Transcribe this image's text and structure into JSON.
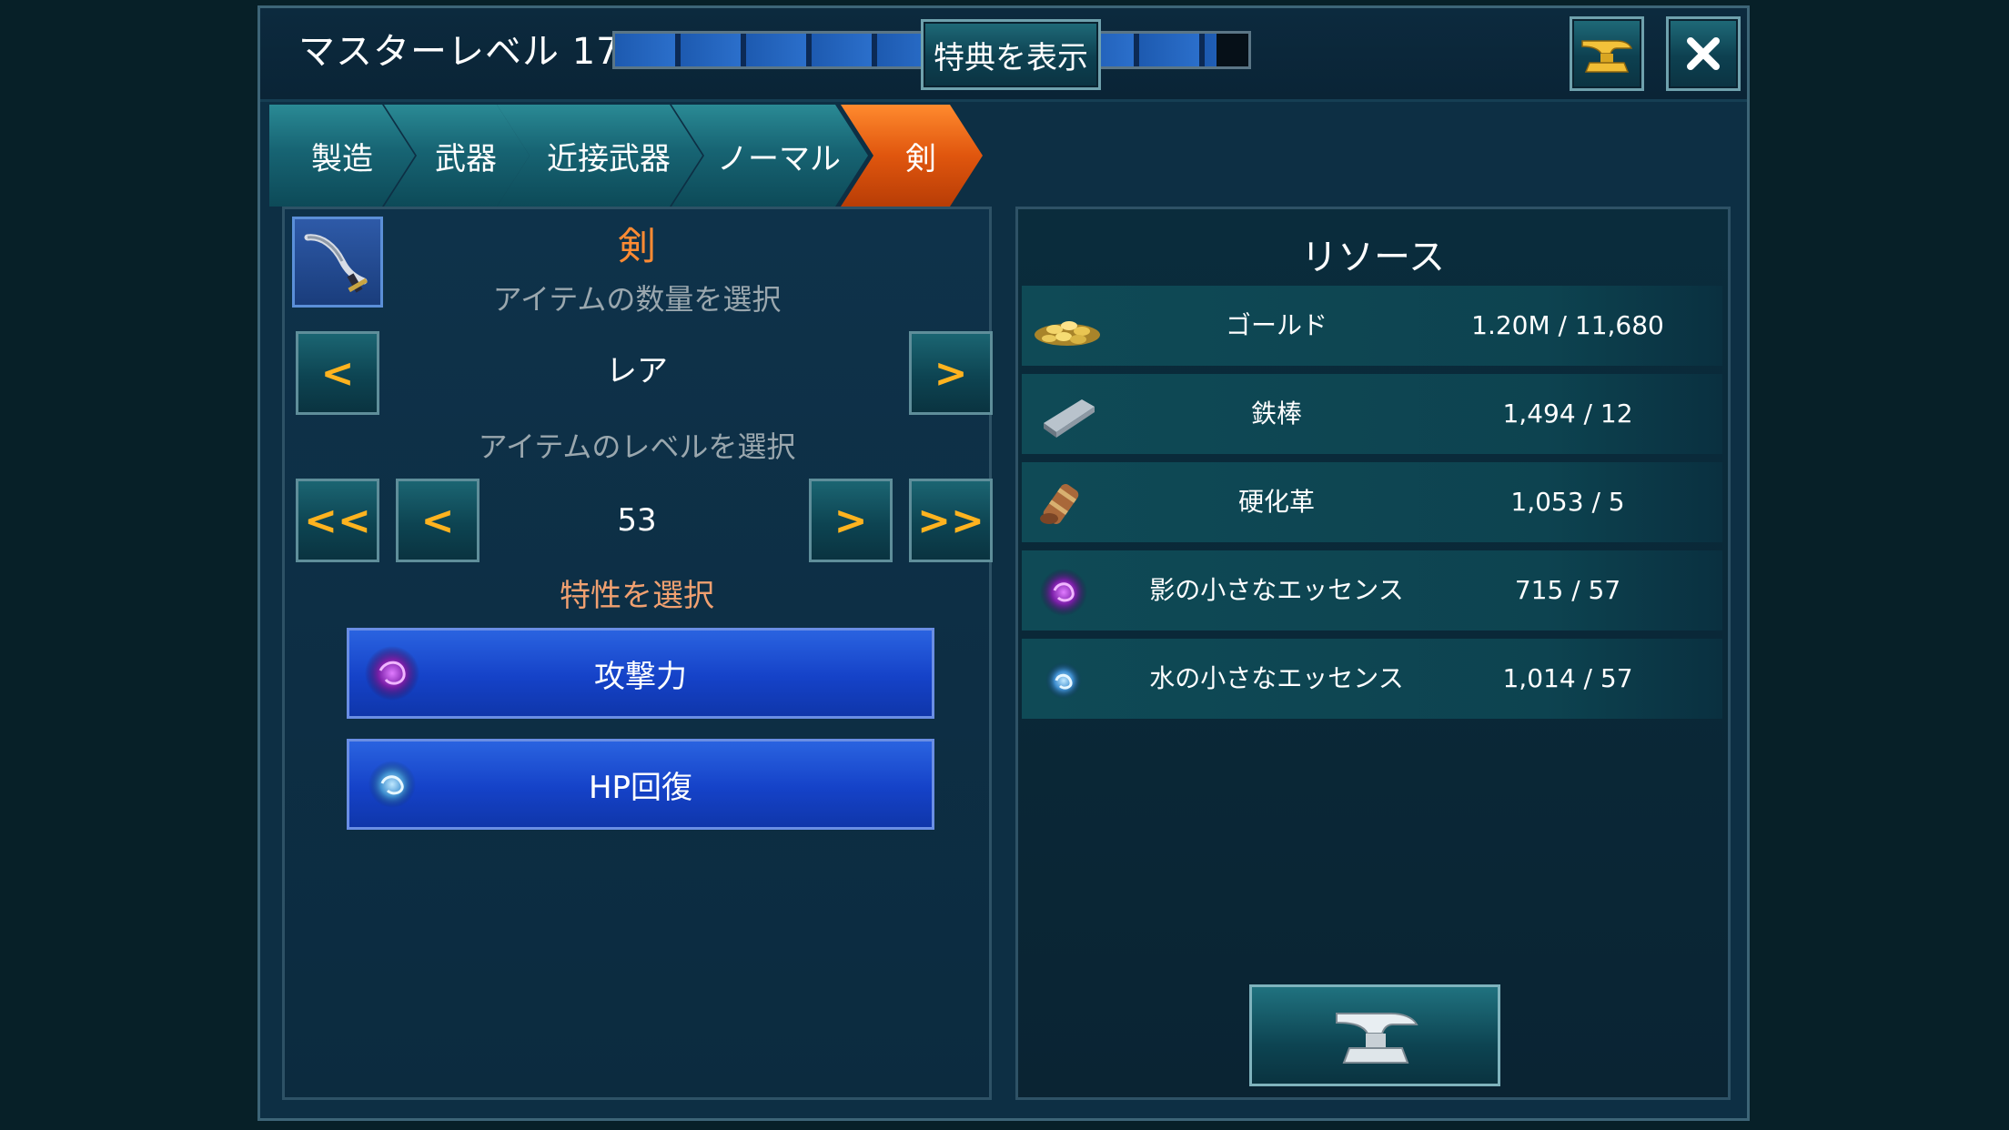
{
  "header": {
    "master_level_label": "マスターレベル 17",
    "xp_progress": 0.95,
    "benefits_button": "特典を表示"
  },
  "tabs": [
    {
      "label": "製造"
    },
    {
      "label": "武器"
    },
    {
      "label": "近接武器"
    },
    {
      "label": "ノーマル"
    },
    {
      "label": "剣",
      "active": true
    }
  ],
  "left": {
    "item_title": "剣",
    "quantity_prompt": "アイテムの数量を選択",
    "rarity_value": "レア",
    "level_prompt": "アイテムのレベルを選択",
    "level_value": "53",
    "trait_prompt": "特性を選択",
    "traits": [
      {
        "label": "攻撃力",
        "icon": "shadow-essence-icon"
      },
      {
        "label": "HP回復",
        "icon": "water-essence-icon"
      }
    ],
    "arrows": {
      "prev": "<",
      "next": ">",
      "first": "<<",
      "last": ">>"
    }
  },
  "resources": {
    "title": "リソース",
    "items": [
      {
        "name": "ゴールド",
        "amount": "1.20M / 11,680",
        "icon": "gold-coins-icon"
      },
      {
        "name": "鉄棒",
        "amount": "1,494 / 12",
        "icon": "iron-bar-icon"
      },
      {
        "name": "硬化革",
        "amount": "1,053 / 5",
        "icon": "hardened-leather-icon"
      },
      {
        "name": "影の小さなエッセンス",
        "amount": "715 / 57",
        "icon": "shadow-essence-icon"
      },
      {
        "name": "水の小さなエッセンス",
        "amount": "1,014 / 57",
        "icon": "water-essence-icon"
      }
    ]
  },
  "colors": {
    "accent_orange": "#ff8b33",
    "arrow_yellow": "#ffb31f",
    "trait_blue": "#1f4fd6",
    "tab_teal": "#176473"
  }
}
